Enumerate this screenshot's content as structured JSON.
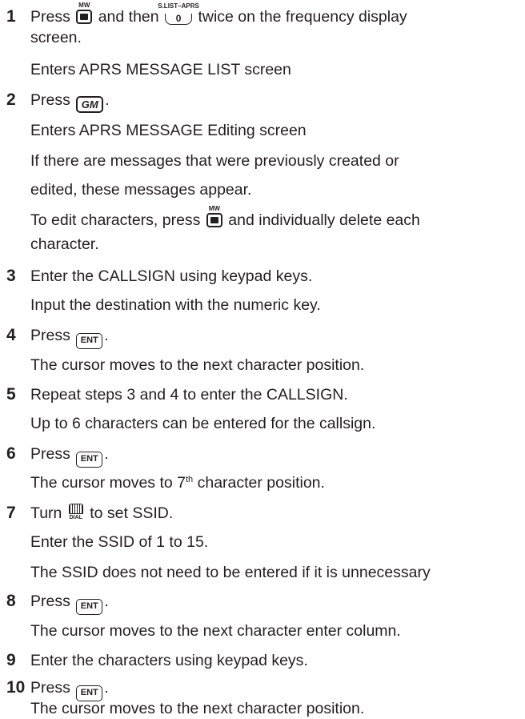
{
  "keys": {
    "mw_label": "MW",
    "slist_label": "S.LIST–APRS",
    "zero_label": "0",
    "gm_label": "GM",
    "ent_label": "ENT",
    "dial_label": "DIAL"
  },
  "steps": [
    {
      "num": "1",
      "parts": {
        "a": "Press",
        "b": "and then",
        "c": "twice on the frequency display"
      },
      "lines": [
        "screen."
      ],
      "subs": [
        "Enters APRS MESSAGE LIST screen"
      ]
    },
    {
      "num": "2",
      "text": "Press",
      "tail": ".",
      "subs": [
        "Enters APRS MESSAGE Editing screen",
        "If there are messages that were previously created or",
        "edited, these messages appear."
      ],
      "edit": {
        "a": "To edit characters, press",
        "b": "and individually delete each"
      },
      "edit_line2": "character."
    },
    {
      "num": "3",
      "text": "Enter the CALLSIGN using keypad keys.",
      "subs": [
        "Input the destination with the numeric key."
      ]
    },
    {
      "num": "4",
      "text": "Press",
      "tail": ".",
      "subs": [
        "The cursor moves to the next character position."
      ]
    },
    {
      "num": "5",
      "text": "Repeat steps 3 and 4 to enter the CALLSIGN.",
      "subs": [
        "Up to 6 characters can be entered for the callsign."
      ]
    },
    {
      "num": "6",
      "text": "Press",
      "tail": ".",
      "sub_a": "The cursor moves to 7",
      "sub_sup": "th",
      "sub_b": " character position."
    },
    {
      "num": "7",
      "text_a": "Turn",
      "text_b": "to set SSID.",
      "subs": [
        "Enter the SSID of 1 to 15.",
        "The SSID does not need to be entered if it is unnecessary"
      ]
    },
    {
      "num": "8",
      "text": "Press",
      "tail": ".",
      "subs": [
        "The cursor moves to the next character enter column."
      ]
    },
    {
      "num": "9",
      "text": "Enter the characters using keypad keys."
    },
    {
      "num": "10",
      "text": "Press",
      "tail": ".",
      "subs": [
        "The cursor moves to the next character position."
      ]
    }
  ]
}
